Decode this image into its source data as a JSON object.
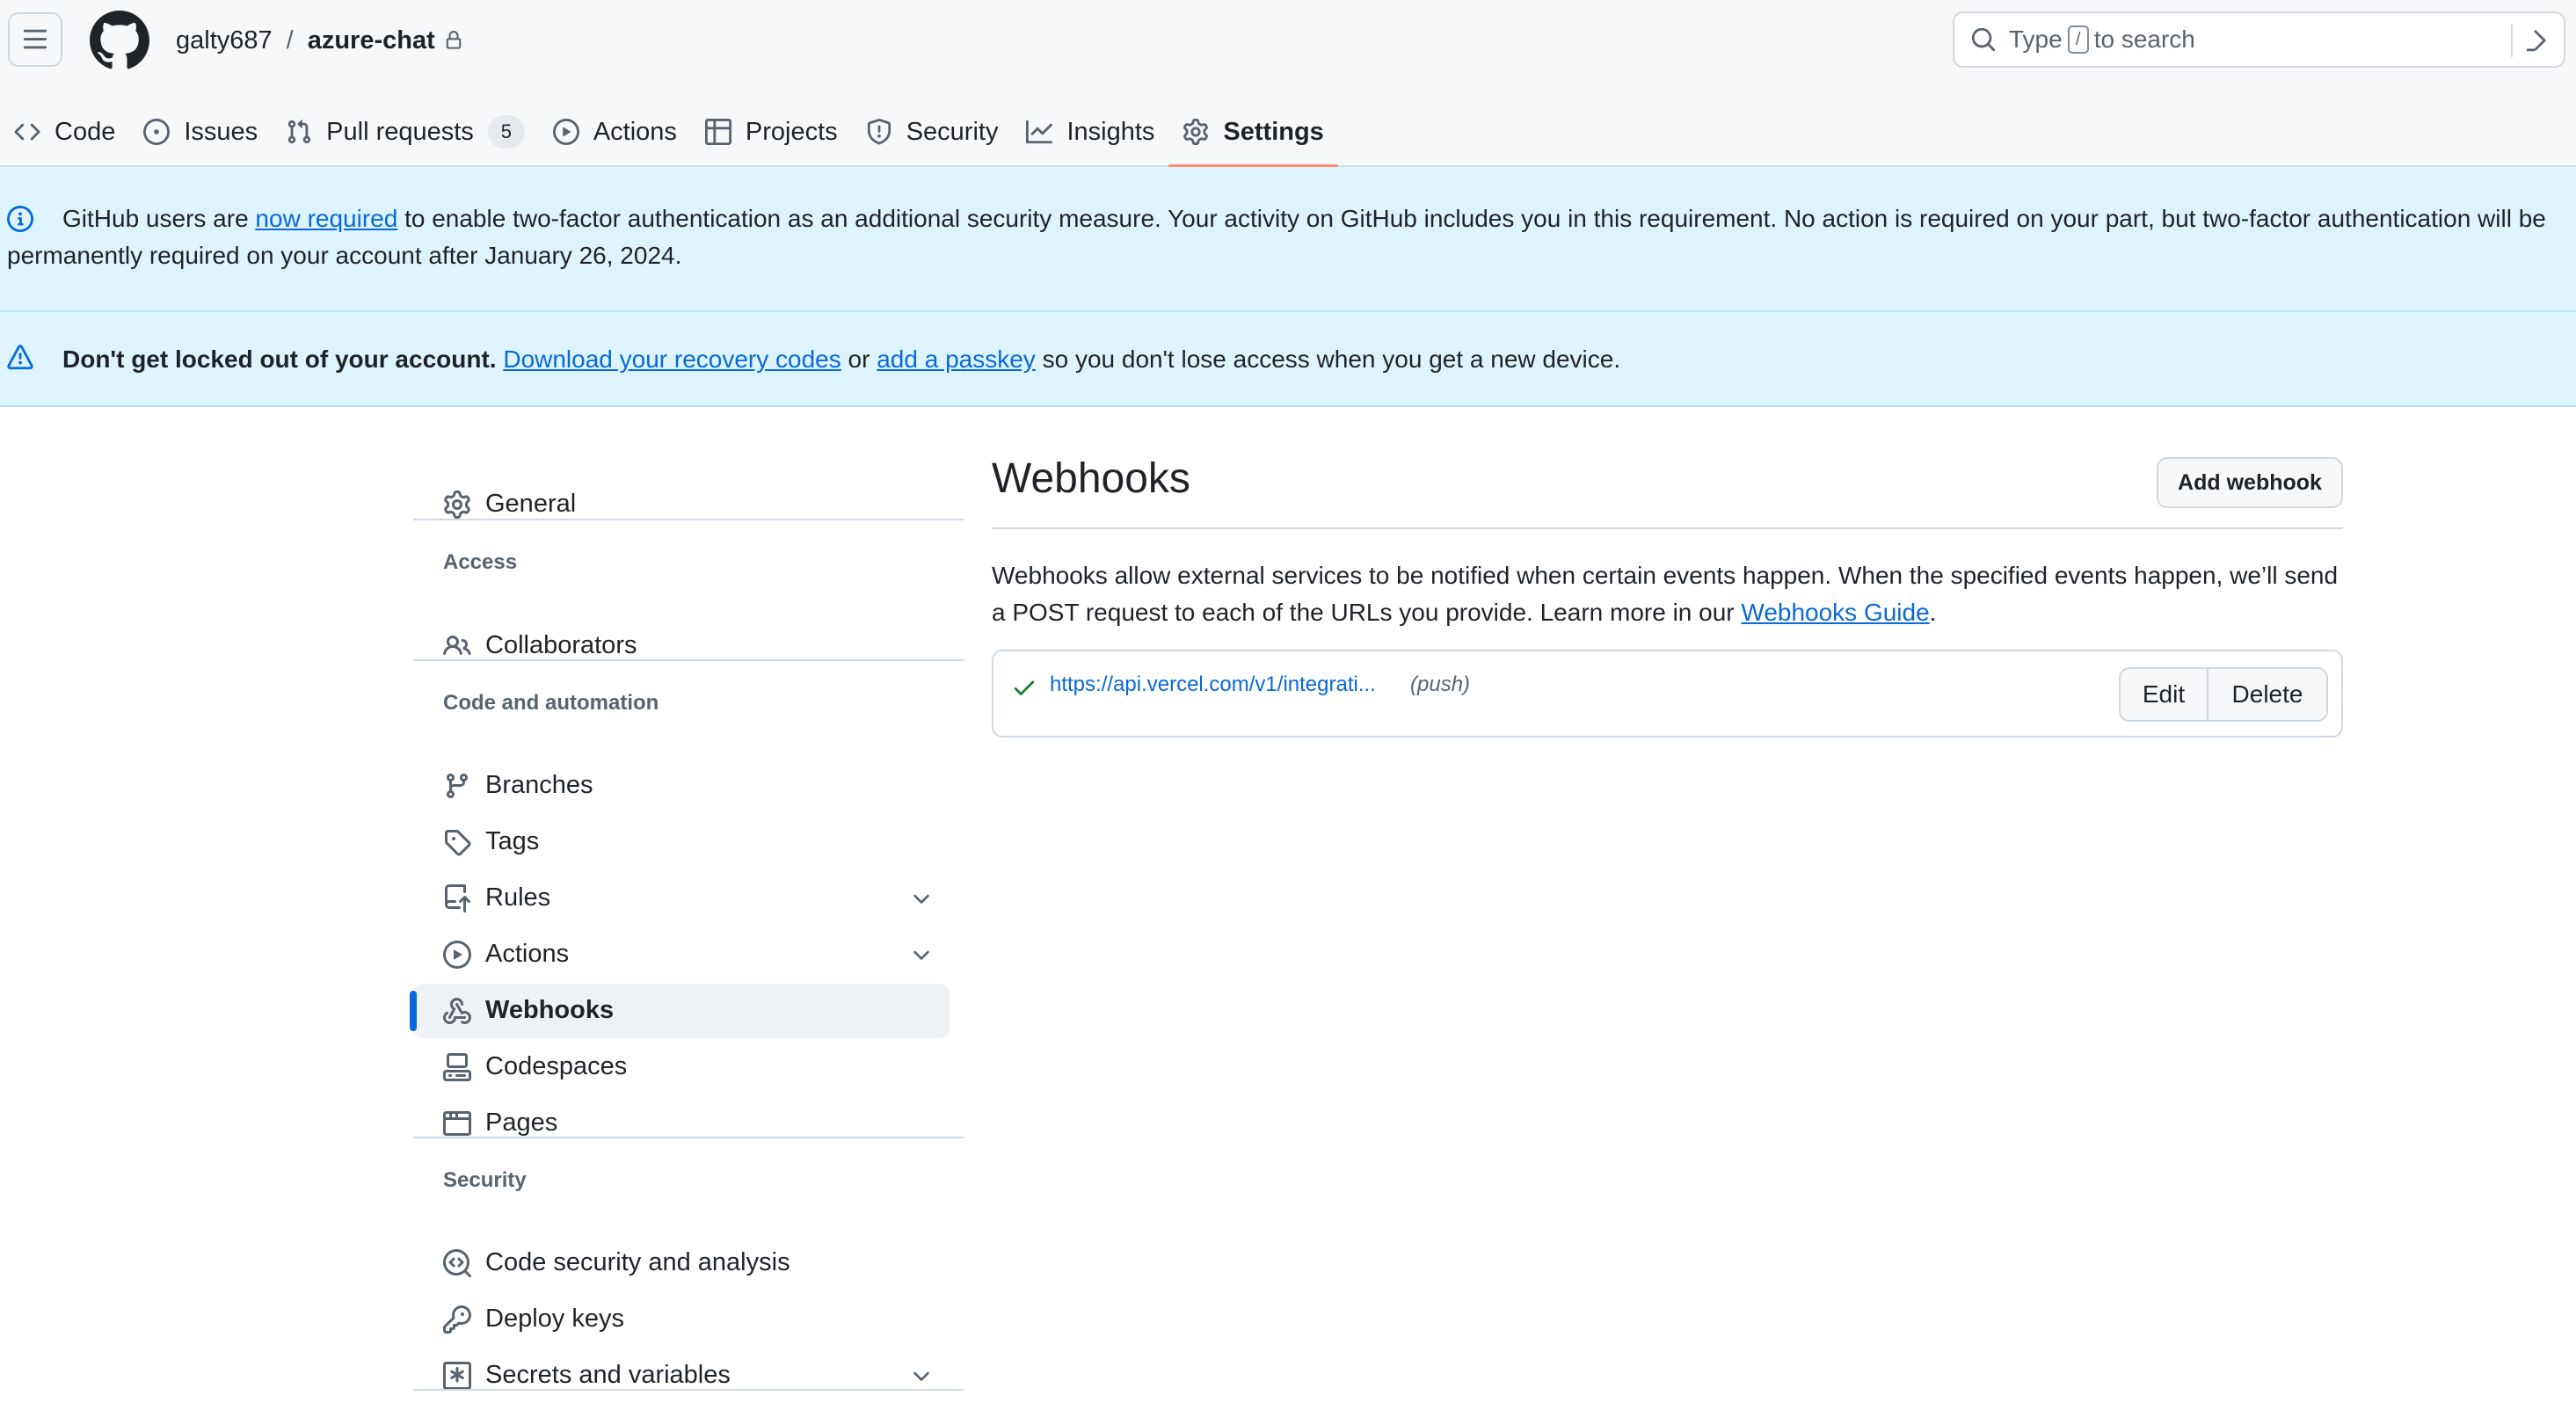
{
  "header": {
    "owner": "galty687",
    "separator": "/",
    "repo": "azure-chat",
    "search_prefix": "Type",
    "search_key": "/",
    "search_suffix": "to search"
  },
  "tabs": [
    {
      "label": "Code",
      "icon": "code-icon"
    },
    {
      "label": "Issues",
      "icon": "issue-icon"
    },
    {
      "label": "Pull requests",
      "icon": "pull-request-icon",
      "count": "5"
    },
    {
      "label": "Actions",
      "icon": "play-icon"
    },
    {
      "label": "Projects",
      "icon": "table-icon"
    },
    {
      "label": "Security",
      "icon": "shield-icon"
    },
    {
      "label": "Insights",
      "icon": "graph-icon"
    },
    {
      "label": "Settings",
      "icon": "gear-icon",
      "selected": true
    }
  ],
  "banners": {
    "twofa": {
      "prefix": "GitHub users are ",
      "link": "now required",
      "suffix": " to enable two-factor authentication as an additional security measure. Your activity on GitHub includes you in this requirement. No action is required on your part, but two-factor authentication will be permanently required on your account after January 26, 2024."
    },
    "lockout": {
      "bold": "Don't get locked out of your account.",
      "link1": "Download your recovery codes",
      "middle": " or ",
      "link2": "add a passkey",
      "suffix": " so you don't lose access when you get a new device."
    }
  },
  "sidebar": {
    "general": "General",
    "groups": {
      "access": "Access",
      "code_automation": "Code and automation",
      "security": "Security"
    },
    "items": {
      "collaborators": "Collaborators",
      "branches": "Branches",
      "tags": "Tags",
      "rules": "Rules",
      "actions": "Actions",
      "webhooks": "Webhooks",
      "codespaces": "Codespaces",
      "pages": "Pages",
      "code_security": "Code security and analysis",
      "deploy_keys": "Deploy keys",
      "secrets": "Secrets and variables"
    },
    "active": "webhooks"
  },
  "main": {
    "title": "Webhooks",
    "add_button": "Add webhook",
    "description_prefix": "Webhooks allow external services to be notified when certain events happen. When the specified events happen, we’ll send a POST request to each of the URLs you provide. Learn more in our ",
    "description_link": "Webhooks Guide",
    "description_suffix": ".",
    "webhooks": [
      {
        "url": "https://api.vercel.com/v1/integrati...",
        "events": "(push)",
        "status": "success",
        "edit_label": "Edit",
        "delete_label": "Delete"
      }
    ]
  },
  "colors": {
    "accent_blue": "#0969da",
    "selected_tab_underline": "#fd8c73",
    "banner_bg": "#ddf4ff",
    "success_green": "#1a7f37"
  }
}
